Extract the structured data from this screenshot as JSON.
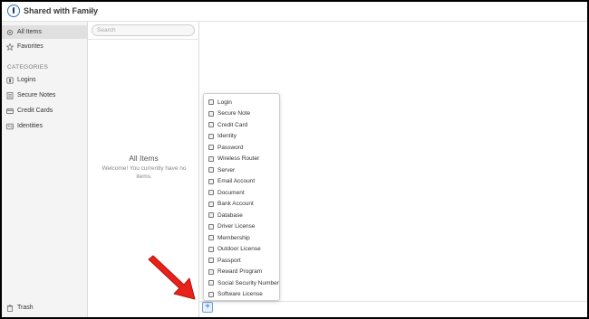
{
  "window": {
    "vault_name": "Shared with Family",
    "chevron": "⌄"
  },
  "sidebar": {
    "items": [
      {
        "label": "All Items",
        "icon": "gear-icon",
        "selected": true
      },
      {
        "label": "Favorites",
        "icon": "star-icon",
        "selected": false
      }
    ],
    "categories_heading": "CATEGORIES",
    "categories": [
      {
        "label": "Logins",
        "icon": "login-icon"
      },
      {
        "label": "Secure Notes",
        "icon": "note-icon"
      },
      {
        "label": "Credit Cards",
        "icon": "credit-card-icon"
      },
      {
        "label": "Identities",
        "icon": "identity-icon"
      }
    ],
    "trash": {
      "label": "Trash",
      "icon": "trash-icon"
    }
  },
  "list": {
    "search_placeholder": "Search",
    "empty_title": "All Items",
    "empty_message": "Welcome! You currently have no items."
  },
  "new_item_menu": {
    "items": [
      "Login",
      "Secure Note",
      "Credit Card",
      "Identity",
      "Password",
      "Wireless Router",
      "Server",
      "Email Account",
      "Document",
      "Bank Account",
      "Database",
      "Driver License",
      "Membership",
      "Outdoor License",
      "Passport",
      "Reward Program",
      "Social Security Number",
      "Software License"
    ]
  },
  "toolbar": {
    "add_label": "+"
  },
  "colors": {
    "accent": "#2f6fc0",
    "arrow": "#e8221b"
  }
}
